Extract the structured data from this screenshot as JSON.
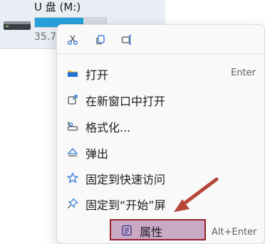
{
  "drive": {
    "name": "U 盘 (M:)",
    "size_text": "35.7",
    "usage_fraction": 0.68,
    "bar_color": "#26a0da"
  },
  "quick_actions": [
    {
      "icon": "cut-icon"
    },
    {
      "icon": "copy-icon"
    },
    {
      "icon": "rename-icon"
    }
  ],
  "menu": {
    "items": [
      {
        "label": "打开",
        "shortcut": "Enter",
        "icon": "folder-icon"
      },
      {
        "label": "在新窗口中打开",
        "shortcut": "",
        "icon": "open-new-window-icon"
      },
      {
        "label": "格式化...",
        "shortcut": "",
        "icon": "format-drive-icon"
      },
      {
        "label": "弹出",
        "shortcut": "",
        "icon": "eject-icon"
      },
      {
        "label": "固定到快速访问",
        "shortcut": "",
        "icon": "star-icon"
      },
      {
        "label": "固定到“开始”屏",
        "shortcut": "",
        "icon": "pin-icon"
      },
      {
        "label": "属性",
        "shortcut": "Alt+Enter",
        "icon": "properties-icon"
      }
    ]
  },
  "colors": {
    "highlight_fill": "#c9a9c6",
    "highlight_border": "#9b1f2b",
    "arrow": "#b5473a",
    "icon_accent": "#2b74d6"
  }
}
